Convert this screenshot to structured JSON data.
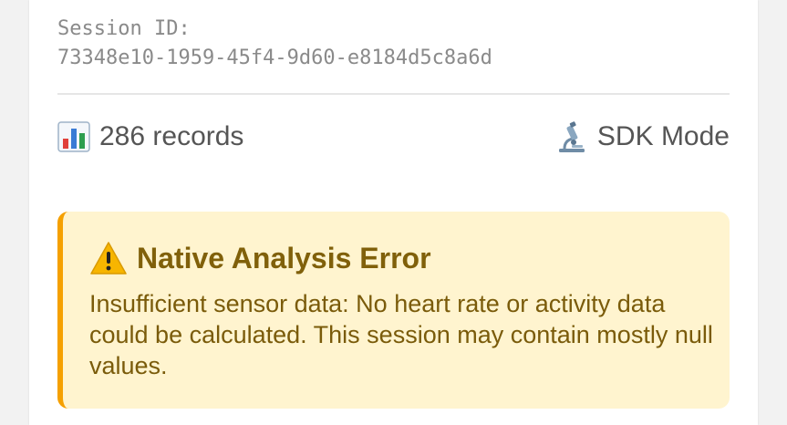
{
  "session": {
    "label": "Session ID:",
    "id": "73348e10-1959-45f4-9d60-e8184d5c8a6d"
  },
  "stats": {
    "records_icon": "bar-chart-icon",
    "records_text": "286 records",
    "mode_icon": "microscope-icon",
    "mode_text": "SDK Mode"
  },
  "error": {
    "icon": "warning-icon",
    "title": "Native Analysis Error",
    "message": "Insufficient sensor data: No heart rate or activity data could be calculated. This session may contain mostly null values.",
    "accent_color": "#f5a000",
    "background_color": "#fff4cf",
    "text_color": "#80600a"
  }
}
